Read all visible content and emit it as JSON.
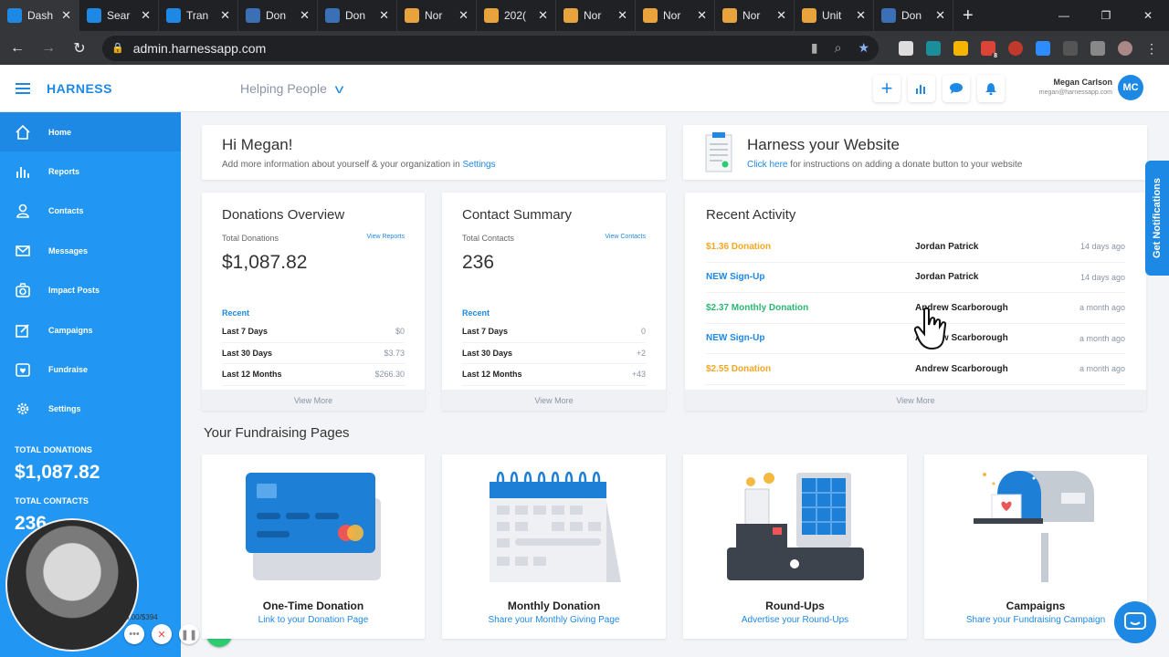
{
  "browser": {
    "tabs": [
      {
        "label": "Dash",
        "color": "#1e88e5",
        "active": true
      },
      {
        "label": "Sear",
        "color": "#1e88e5"
      },
      {
        "label": "Tran",
        "color": "#1e88e5"
      },
      {
        "label": "Don",
        "color": "#3b6fb6"
      },
      {
        "label": "Don",
        "color": "#3b6fb6"
      },
      {
        "label": "Nor",
        "color": "#e8a33c"
      },
      {
        "label": "202(",
        "color": "#e8a33c"
      },
      {
        "label": "Nor",
        "color": "#e8a33c"
      },
      {
        "label": "Nor",
        "color": "#e8a33c"
      },
      {
        "label": "Nor",
        "color": "#e8a33c"
      },
      {
        "label": "Unit",
        "color": "#e8a33c"
      },
      {
        "label": "Don",
        "color": "#3b6fb6"
      }
    ],
    "close_glyph": "✕",
    "new_tab_glyph": "+",
    "url": "admin.harnessapp.com",
    "ext_badge": "8"
  },
  "header": {
    "brand": "HARNESS",
    "org": "Helping People",
    "user_name": "Megan Carlson",
    "user_email": "megan@harnessapp.com",
    "avatar_initials": "MC"
  },
  "sidebar": {
    "items": [
      {
        "label": "Home",
        "icon": "home-icon"
      },
      {
        "label": "Reports",
        "icon": "bar-chart-icon"
      },
      {
        "label": "Contacts",
        "icon": "user-icon"
      },
      {
        "label": "Messages",
        "icon": "envelope-icon"
      },
      {
        "label": "Impact Posts",
        "icon": "camera-icon"
      },
      {
        "label": "Campaigns",
        "icon": "edit-icon"
      },
      {
        "label": "Fundraise",
        "icon": "heart-icon"
      },
      {
        "label": "Settings",
        "icon": "gear-icon"
      }
    ],
    "total_donations_label": "TOTAL DONATIONS",
    "total_donations": "$1,087.82",
    "total_contacts_label": "TOTAL CONTACTS",
    "total_contacts": "236",
    "tally": "0.00/$394"
  },
  "welcome": {
    "title": "Hi Megan!",
    "text": "Add more information about yourself & your organization in ",
    "link": "Settings"
  },
  "website": {
    "title": "Harness your Website",
    "link": "Click here",
    "text": " for instructions on adding a donate button to your website"
  },
  "donations": {
    "title": "Donations Overview",
    "sub_label": "Total Donations",
    "sub_link": "View Reports",
    "total": "$1,087.82",
    "recent": "Recent",
    "rows": [
      {
        "k": "Last 7 Days",
        "v": "$0"
      },
      {
        "k": "Last 30 Days",
        "v": "$3.73"
      },
      {
        "k": "Last 12 Months",
        "v": "$266.30"
      }
    ],
    "more": "View More"
  },
  "contacts": {
    "title": "Contact Summary",
    "sub_label": "Total Contacts",
    "sub_link": "View Contacts",
    "total": "236",
    "recent": "Recent",
    "rows": [
      {
        "k": "Last 7 Days",
        "v": "0"
      },
      {
        "k": "Last 30 Days",
        "v": "+2"
      },
      {
        "k": "Last 12 Months",
        "v": "+43"
      }
    ],
    "more": "View More"
  },
  "activity": {
    "title": "Recent Activity",
    "items": [
      {
        "type": "$1.36 Donation",
        "color": "#f5a623",
        "person": "Jordan Patrick",
        "when": "14 days ago"
      },
      {
        "type": "NEW Sign-Up",
        "color": "#1e88e5",
        "person": "Jordan Patrick",
        "when": "14 days ago"
      },
      {
        "type": "$2.37 Monthly Donation",
        "color": "#2bb673",
        "person": "Andrew Scarborough",
        "when": "a month ago"
      },
      {
        "type": "NEW Sign-Up",
        "color": "#1e88e5",
        "person": "Andrew Scarborough",
        "when": "a month ago"
      },
      {
        "type": "$2.55 Donation",
        "color": "#f5a623",
        "person": "Andrew Scarborough",
        "when": "a month ago"
      }
    ],
    "more": "View More"
  },
  "fundraising": {
    "title": "Your Fundraising Pages",
    "pages": [
      {
        "title": "One-Time Donation",
        "link": "Link to your Donation Page",
        "icon": "credit-card-icon"
      },
      {
        "title": "Monthly Donation",
        "link": "Share your Monthly Giving Page",
        "icon": "calendar-icon"
      },
      {
        "title": "Round-Ups",
        "link": "Advertise your Round-Ups",
        "icon": "cash-register-icon"
      },
      {
        "title": "Campaigns",
        "link": "Share your Fundraising Campaign",
        "icon": "mailbox-icon"
      }
    ]
  },
  "get_notifications": "Get Notifications"
}
